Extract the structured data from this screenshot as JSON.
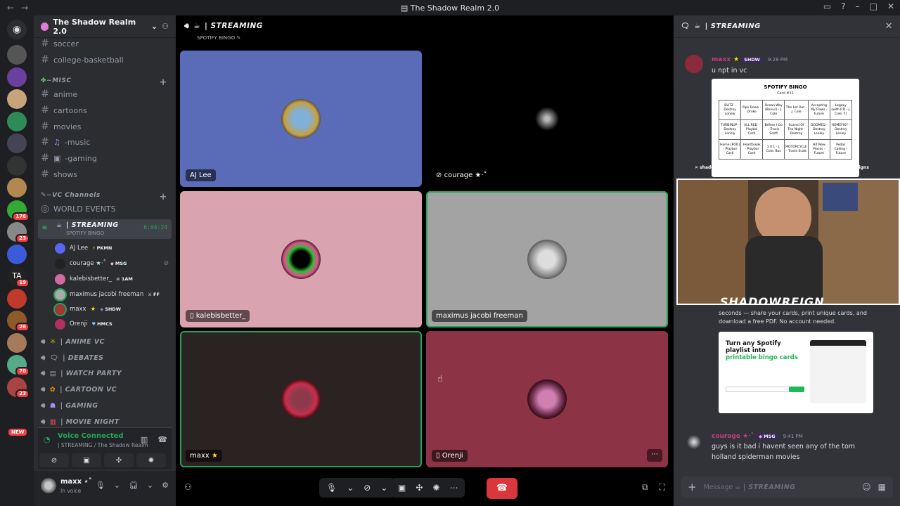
{
  "window": {
    "title": "The Shadow Realm 2.0"
  },
  "colors": {
    "green": "#23a55a",
    "red": "#da373c",
    "blurple": "#5865f2",
    "bg": "#1e1f22"
  },
  "server_badges": [
    "176",
    "23",
    "19",
    "26",
    "70",
    "23"
  ],
  "new_badge": "NEW",
  "guild": {
    "name": "The Shadow Realm 2.0"
  },
  "channels_top": [
    "soccer",
    "college-basketball"
  ],
  "misc": {
    "category": "~MISC",
    "channels": [
      "anime",
      "cartoons",
      "movies",
      "-music",
      "-gaming",
      "shows"
    ]
  },
  "vc_category": "~VC Channels",
  "world_events": "WORLD EVENTS",
  "active_vc": {
    "name": "| STREAMING",
    "sub": "SPOTIFY BINGO",
    "time": "6:04:24"
  },
  "members": [
    {
      "name": "AJ Lee",
      "tag": "PKMN"
    },
    {
      "name": "courage ★·˚",
      "tag": "MSG"
    },
    {
      "name": "kalebisbetter_",
      "tag": "1AM"
    },
    {
      "name": "maximus jacobi freeman",
      "tag": "FF"
    },
    {
      "name": "maxx",
      "tag": "SHDW"
    },
    {
      "name": "Orenji",
      "tag": "HMCS"
    }
  ],
  "voice_channels": [
    "| ANIME VC",
    "| DEBATES",
    "| WATCH PARTY",
    "| CARTOON VC",
    "| GAMING",
    "| MOVIE NIGHT"
  ],
  "voice_panel": {
    "status": "Voice Connected",
    "where": "| STREAMING / The Shadow Realm ..."
  },
  "user": {
    "name": "maxx ⋆˚",
    "status": "In voice"
  },
  "stage": {
    "title": "| STREAMING",
    "subtitle": "SPOTIFY BINGO",
    "tiles": [
      {
        "label": "AJ Lee"
      },
      {
        "label": "courage ★·˚"
      },
      {
        "label": "kalebisbetter_"
      },
      {
        "label": "maximus jacobi freeman"
      },
      {
        "label": "maxx"
      },
      {
        "label": "Orenji"
      }
    ]
  },
  "chat": {
    "title": "| STREAMING",
    "msg1": {
      "author": "maxx",
      "tag": "SHDW",
      "time": "9:28 PM",
      "text": "u npt in vc"
    },
    "bingo": {
      "title": "SPOTIFY BINGO",
      "sub": "Card #11",
      "cells": [
        "BLITZ - Destroy Lonely",
        "Pipe Down - Drake",
        "Ocean Way (Bonus) - J. Cole",
        "The Let Out - J. Cole",
        "Accepting My Flaws - Future",
        "Legacy (with P.D - J. Cole, F.)",
        "TURNINUP - Destroy Lonely",
        "ALL RED - Playboi Carti",
        "Before I Go - Travis Scott",
        "Scared Of The Night - Destroy",
        "DOOMED - Destroy Lonely",
        "HOMEFIXY - Destroy Lonely",
        "Home (KOD) - Playboi Carti",
        "Heartbreak - Playboi Carti",
        "1 0 1 - J. Cole, Bas",
        "MOTORCYCLE - Travis Scott",
        "Hit New Places - Future",
        "Pedas Calling - Future"
      ]
    },
    "socials": [
      "shadowr3ignx",
      "shadowr3ignx",
      "shadowr3ignx",
      "shadowr3ignx"
    ],
    "logo": "SHADOWREIGN",
    "promo_text": "seconds — share your cards, print unique cards, and download a free PDF. No account needed.",
    "promo": {
      "headline": "Turn any Spotify playlist into",
      "highlight": "printable bingo cards"
    },
    "msg2": {
      "author": "courage ★·˚",
      "tag": "MSG",
      "time": "9:41 PM",
      "text": "guys is it bad i havent seen any of the tom holland spiderman movies"
    },
    "input_placeholder": "Message",
    "input_channel": "| STREAMING"
  }
}
